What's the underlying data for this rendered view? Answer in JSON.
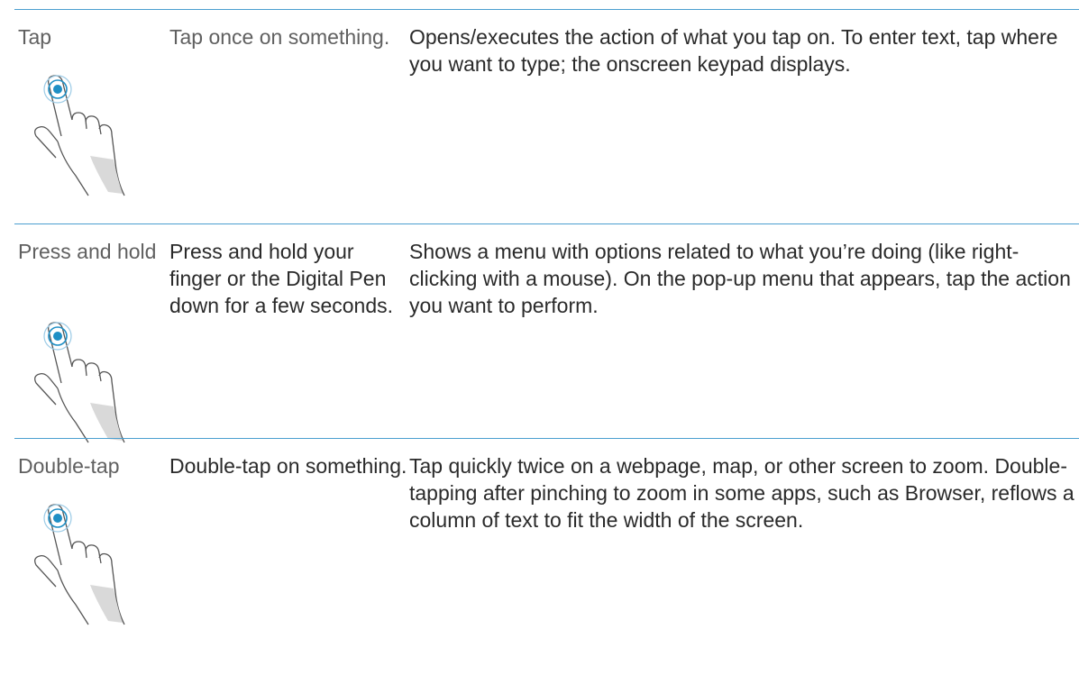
{
  "rows": [
    {
      "gesture": "Tap",
      "action": "Tap once on something.",
      "result": "Opens/executes the action of what you tap on. To enter text, tap where you want to type; the onscreen keypad displays.",
      "icon": "hand-tap-icon"
    },
    {
      "gesture": "Press and hold",
      "action": "Press and hold your finger or the Digital Pen down for a few seconds.",
      "result": "Shows a menu with options related to what you’re doing (like right-clicking with a mouse). On the pop-up menu that appears, tap the action you want to perform.",
      "icon": "hand-tap-icon"
    },
    {
      "gesture": "Double-tap",
      "action": "Double-tap on something.",
      "result": "Tap quickly twice on a webpage, map, or other screen to zoom. Double-tapping after pinching to zoom in some apps, such as Browser, reflows a column of text to fit the width of the screen.",
      "icon": "hand-tap-icon"
    }
  ],
  "colors": {
    "rule": "#4a9fd0",
    "touch_point": "#1f8fc5",
    "hand_shade": "#d9d9d9"
  }
}
